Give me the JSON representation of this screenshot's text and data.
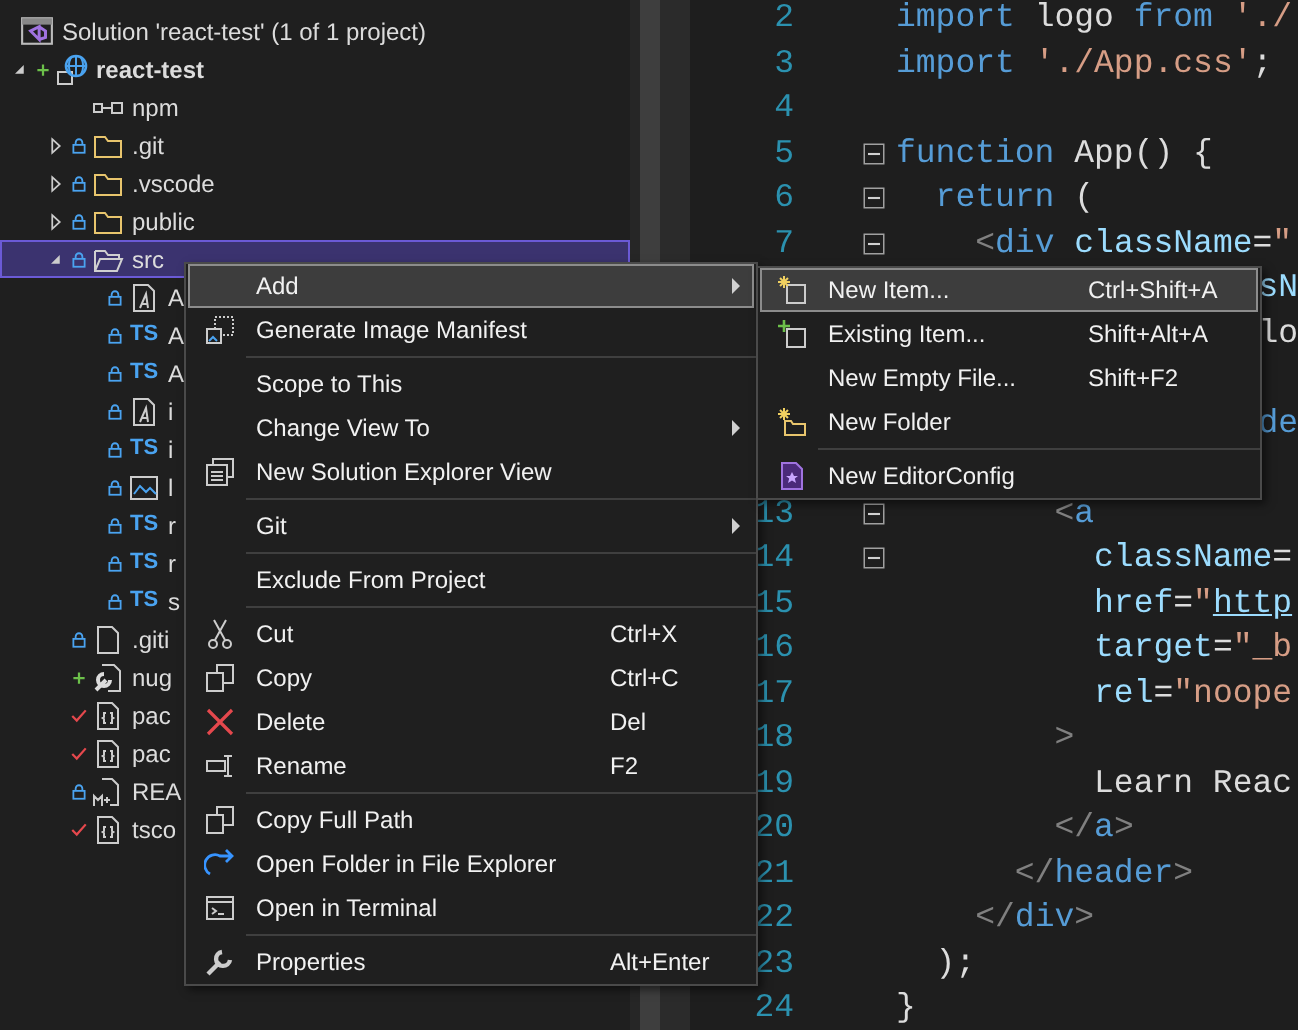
{
  "solution_explorer": {
    "solution": {
      "label": "Solution 'react-test' (1 of 1 project)"
    },
    "tree": [
      {
        "label": "react-test",
        "kind": "web-project",
        "locked": false,
        "added": true,
        "modified": false,
        "expanded": true,
        "selected": false,
        "startup_project": true,
        "children": [
          {
            "label": "npm",
            "kind": "npm",
            "locked": false,
            "added": false,
            "modified": false,
            "selected": false
          },
          {
            "label": ".git",
            "kind": "folder",
            "locked": true,
            "added": false,
            "modified": false,
            "expanded": false,
            "selected": false
          },
          {
            "label": ".vscode",
            "kind": "folder",
            "locked": true,
            "added": false,
            "modified": false,
            "expanded": false,
            "selected": false
          },
          {
            "label": "public",
            "kind": "folder",
            "locked": true,
            "added": false,
            "modified": false,
            "expanded": false,
            "selected": false
          },
          {
            "label": "src",
            "kind": "folder",
            "locked": true,
            "added": false,
            "modified": false,
            "expanded": true,
            "selected": true,
            "children": [
              {
                "label": "A",
                "kind": "style-file",
                "locked": true,
                "added": false,
                "modified": false,
                "selected": false
              },
              {
                "label": "A",
                "kind": "ts",
                "badge": "TS",
                "locked": true,
                "added": false,
                "modified": false,
                "selected": false
              },
              {
                "label": "A",
                "kind": "ts",
                "badge": "TS",
                "locked": true,
                "added": false,
                "modified": false,
                "selected": false
              },
              {
                "label": "i",
                "kind": "style-file",
                "locked": true,
                "added": false,
                "modified": false,
                "selected": false
              },
              {
                "label": "i",
                "kind": "ts",
                "badge": "TS",
                "locked": true,
                "added": false,
                "modified": false,
                "selected": false
              },
              {
                "label": "l",
                "kind": "image",
                "locked": true,
                "added": false,
                "modified": false,
                "selected": false
              },
              {
                "label": "r",
                "kind": "ts",
                "badge": "TS",
                "locked": true,
                "added": false,
                "modified": false,
                "selected": false
              },
              {
                "label": "r",
                "kind": "ts",
                "badge": "TS",
                "locked": true,
                "added": false,
                "modified": false,
                "selected": false
              },
              {
                "label": "s",
                "kind": "ts",
                "badge": "TS",
                "locked": true,
                "added": false,
                "modified": false,
                "selected": false
              }
            ]
          },
          {
            "label": ".giti",
            "kind": "file",
            "locked": true,
            "added": false,
            "modified": false,
            "selected": false
          },
          {
            "label": "nug",
            "kind": "wrench-file",
            "locked": false,
            "added": true,
            "modified": false,
            "selected": false
          },
          {
            "label": "pac",
            "kind": "json",
            "locked": false,
            "added": false,
            "modified": true,
            "selected": false
          },
          {
            "label": "pac",
            "kind": "json",
            "locked": false,
            "added": false,
            "modified": true,
            "selected": false
          },
          {
            "label": "REA",
            "kind": "markdown",
            "locked": true,
            "added": false,
            "modified": false,
            "selected": false
          },
          {
            "label": "tsco",
            "kind": "json",
            "locked": false,
            "added": false,
            "modified": true,
            "selected": false
          }
        ]
      }
    ]
  },
  "context_menu": {
    "items": [
      {
        "kind": "item",
        "label": "Add",
        "submenu": true,
        "highlighted": true
      },
      {
        "kind": "image-manifest",
        "label": "Generate Image Manifest",
        "submenu": false,
        "highlighted": false
      },
      {
        "kind": "separator"
      },
      {
        "kind": "item",
        "label": "Scope to This",
        "submenu": false,
        "highlighted": false
      },
      {
        "kind": "item",
        "label": "Change View To",
        "submenu": true,
        "highlighted": false
      },
      {
        "kind": "windows",
        "label": "New Solution Explorer View",
        "submenu": false,
        "highlighted": false
      },
      {
        "kind": "separator"
      },
      {
        "kind": "item",
        "label": "Git",
        "submenu": true,
        "highlighted": false
      },
      {
        "kind": "separator"
      },
      {
        "kind": "item",
        "label": "Exclude From Project",
        "submenu": false,
        "highlighted": false
      },
      {
        "kind": "separator"
      },
      {
        "kind": "scissors",
        "label": "Cut",
        "shortcut": "Ctrl+X",
        "submenu": false,
        "highlighted": false
      },
      {
        "kind": "copy",
        "label": "Copy",
        "shortcut": "Ctrl+C",
        "submenu": false,
        "highlighted": false
      },
      {
        "kind": "delete",
        "label": "Delete",
        "shortcut": "Del",
        "submenu": false,
        "highlighted": false
      },
      {
        "kind": "rename",
        "label": "Rename",
        "shortcut": "F2",
        "submenu": false,
        "highlighted": false
      },
      {
        "kind": "separator"
      },
      {
        "kind": "copy",
        "label": "Copy Full Path",
        "submenu": false,
        "highlighted": false
      },
      {
        "kind": "redo",
        "label": "Open Folder in File Explorer",
        "submenu": false,
        "highlighted": false
      },
      {
        "kind": "terminal",
        "label": "Open in Terminal",
        "submenu": false,
        "highlighted": false
      },
      {
        "kind": "separator"
      },
      {
        "kind": "wrench",
        "label": "Properties",
        "shortcut": "Alt+Enter",
        "submenu": false,
        "highlighted": false
      }
    ]
  },
  "add_submenu": {
    "items": [
      {
        "kind": "new-item",
        "label": "New Item...",
        "shortcut": "Ctrl+Shift+A",
        "highlighted": true
      },
      {
        "kind": "existing-item",
        "label": "Existing Item...",
        "shortcut": "Shift+Alt+A",
        "highlighted": false
      },
      {
        "kind": "item",
        "label": "New Empty File...",
        "shortcut": "Shift+F2",
        "highlighted": false
      },
      {
        "kind": "new-folder",
        "label": "New Folder",
        "highlighted": false
      },
      {
        "kind": "separator"
      },
      {
        "kind": "editorconfig",
        "label": "New EditorConfig",
        "highlighted": false
      }
    ]
  },
  "editor": {
    "lines": [
      {
        "kind": "code",
        "number": "2",
        "fold": false,
        "tokens": [
          {
            "kind": "keyword",
            "text": "import"
          },
          {
            "kind": "name",
            "text": " logo "
          },
          {
            "kind": "keyword",
            "text": "from"
          },
          {
            "kind": "string",
            "text": " './"
          }
        ]
      },
      {
        "kind": "code",
        "number": "3",
        "fold": false,
        "tokens": [
          {
            "kind": "keyword",
            "text": "import"
          },
          {
            "kind": "string",
            "text": " './App.css'"
          },
          {
            "kind": "name",
            "text": ";"
          }
        ]
      },
      {
        "kind": "code",
        "number": "4",
        "fold": false
      },
      {
        "kind": "code",
        "number": "5",
        "fold": true,
        "tokens": [
          {
            "kind": "keyword",
            "text": "function"
          },
          {
            "kind": "name",
            "text": " App() {"
          }
        ]
      },
      {
        "kind": "code",
        "number": "6",
        "fold": true,
        "tokens": [
          {
            "kind": "keyword",
            "text": "  return"
          },
          {
            "kind": "name",
            "text": " ("
          }
        ]
      },
      {
        "kind": "code",
        "number": "7",
        "fold": true,
        "tokens": [
          {
            "kind": "punct",
            "text": "    <"
          },
          {
            "kind": "tag",
            "text": "div"
          },
          {
            "kind": "attr",
            "text": " className"
          },
          {
            "kind": "name",
            "text": "="
          },
          {
            "kind": "string",
            "text": "\""
          }
        ]
      },
      {
        "kind": "fragment",
        "tokens": [
          {
            "kind": "attr",
            "text": "sN"
          }
        ]
      },
      {
        "kind": "fragment",
        "tokens": [
          {
            "kind": "name",
            "text": "lo"
          }
        ]
      },
      {
        "kind": "blank"
      },
      {
        "kind": "fragment",
        "tokens": [
          {
            "kind": "tag",
            "text": "de"
          }
        ]
      },
      {
        "kind": "blank"
      },
      {
        "kind": "code",
        "number": "13",
        "fold": true,
        "tokens": [
          {
            "kind": "punct",
            "text": "        <"
          },
          {
            "kind": "tag",
            "text": "a"
          }
        ]
      },
      {
        "kind": "code",
        "number": "14",
        "fold": true,
        "tokens": [
          {
            "kind": "attr",
            "text": "          className"
          },
          {
            "kind": "name",
            "text": "="
          }
        ]
      },
      {
        "kind": "code",
        "number": "15",
        "fold": false,
        "tokens": [
          {
            "kind": "attr",
            "text": "          href"
          },
          {
            "kind": "name",
            "text": "="
          },
          {
            "kind": "string",
            "text": "\""
          },
          {
            "kind": "link",
            "text": "http"
          }
        ]
      },
      {
        "kind": "code",
        "number": "16",
        "fold": false,
        "tokens": [
          {
            "kind": "attr",
            "text": "          target"
          },
          {
            "kind": "name",
            "text": "="
          },
          {
            "kind": "string",
            "text": "\"_b"
          }
        ]
      },
      {
        "kind": "code",
        "number": "17",
        "fold": false,
        "tokens": [
          {
            "kind": "attr",
            "text": "          rel"
          },
          {
            "kind": "name",
            "text": "="
          },
          {
            "kind": "string",
            "text": "\"noope"
          }
        ]
      },
      {
        "kind": "code",
        "number": "18",
        "fold": false,
        "tokens": [
          {
            "kind": "punct",
            "text": "        >"
          }
        ]
      },
      {
        "kind": "code",
        "number": "19",
        "fold": false,
        "tokens": [
          {
            "kind": "name",
            "text": "          Learn Reac"
          }
        ]
      },
      {
        "kind": "code",
        "number": "20",
        "fold": false,
        "tokens": [
          {
            "kind": "punct",
            "text": "        </"
          },
          {
            "kind": "tag",
            "text": "a"
          },
          {
            "kind": "punct",
            "text": ">"
          }
        ]
      },
      {
        "kind": "code",
        "number": "21",
        "fold": false,
        "tokens": [
          {
            "kind": "punct",
            "text": "      </"
          },
          {
            "kind": "tag",
            "text": "header"
          },
          {
            "kind": "punct",
            "text": ">"
          }
        ]
      },
      {
        "kind": "code",
        "number": "22",
        "fold": false,
        "tokens": [
          {
            "kind": "punct",
            "text": "    </"
          },
          {
            "kind": "tag",
            "text": "div"
          },
          {
            "kind": "punct",
            "text": ">"
          }
        ]
      },
      {
        "kind": "code",
        "number": "23",
        "fold": false,
        "tokens": [
          {
            "kind": "name",
            "text": "  );"
          }
        ]
      },
      {
        "kind": "code",
        "number": "24",
        "fold": false,
        "tokens": [
          {
            "kind": "name",
            "text": "}"
          }
        ]
      }
    ]
  }
}
